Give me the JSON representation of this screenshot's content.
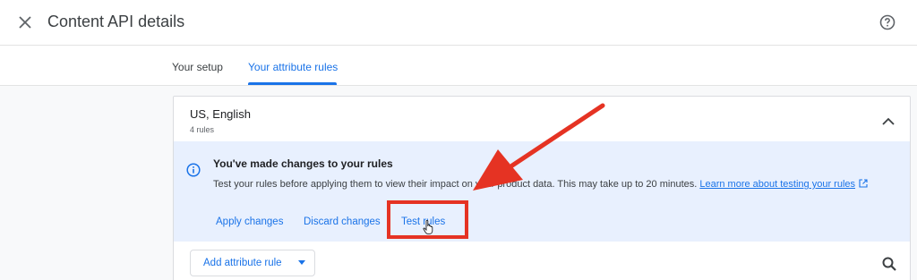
{
  "header": {
    "title": "Content API details",
    "close_icon": "close-icon",
    "help_icon": "help-icon"
  },
  "tabs": [
    {
      "label": "Your setup",
      "active": false
    },
    {
      "label": "Your attribute rules",
      "active": true
    }
  ],
  "card": {
    "region": "US, English",
    "rules_count": "4 rules",
    "notice": {
      "title": "You've made changes to your rules",
      "body": "Test your rules before applying them to view their impact on your product data. This may take up to 20 minutes. ",
      "link": "Learn more about testing your rules"
    },
    "actions": {
      "apply": "Apply changes",
      "discard": "Discard changes",
      "test": "Test rules"
    },
    "add_rule_label": "Add attribute rule"
  },
  "colors": {
    "accent": "#1a73e8",
    "annotation": "#e53323",
    "notice_bg": "#e8f0fe"
  }
}
